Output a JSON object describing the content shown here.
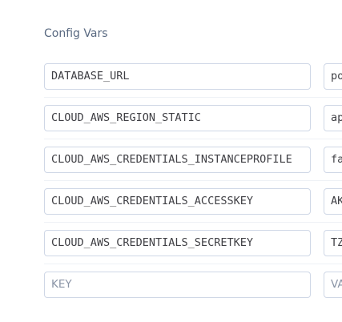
{
  "section": {
    "title": "Config Vars"
  },
  "config_vars": [
    {
      "key": "DATABASE_URL",
      "value": "po"
    },
    {
      "key": "CLOUD_AWS_REGION_STATIC",
      "value": "ap"
    },
    {
      "key": "CLOUD_AWS_CREDENTIALS_INSTANCEPROFILE",
      "value": "fa"
    },
    {
      "key": "CLOUD_AWS_CREDENTIALS_ACCESSKEY",
      "value": "AK"
    },
    {
      "key": "CLOUD_AWS_CREDENTIALS_SECRETKEY",
      "value": "TZ"
    }
  ],
  "new_var": {
    "key_placeholder": "KEY",
    "value_placeholder": "VA"
  }
}
